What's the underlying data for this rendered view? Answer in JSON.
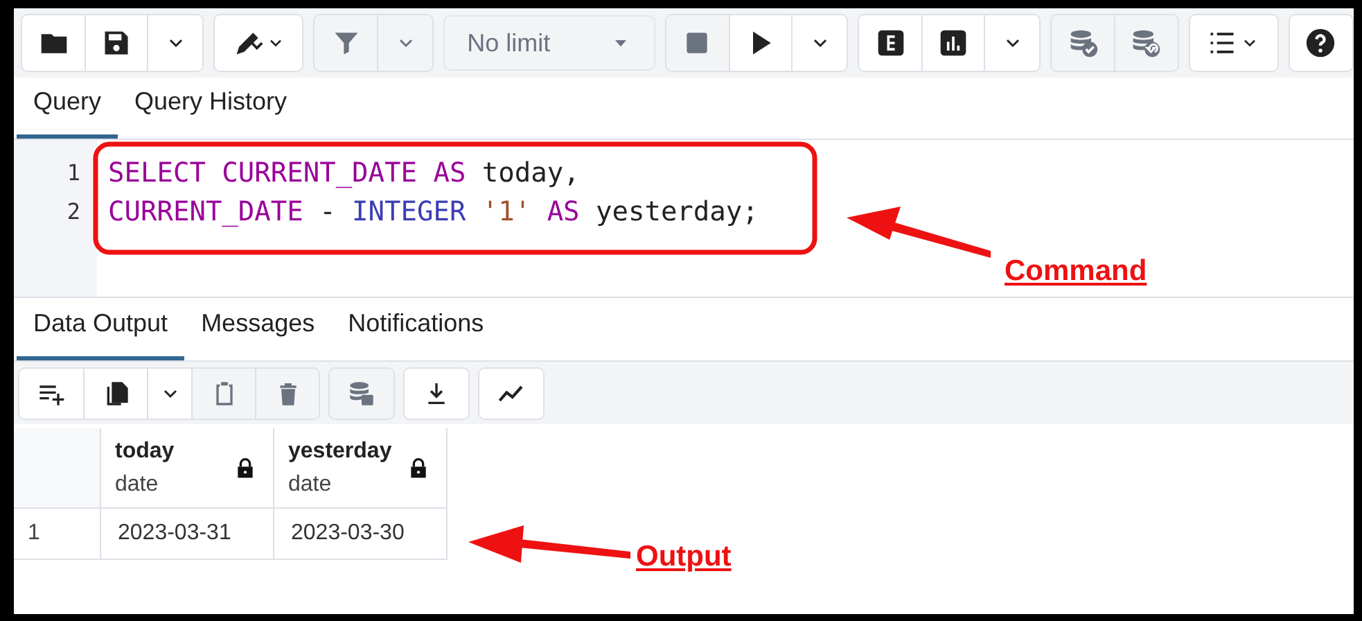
{
  "toolbar": [
    [
      {
        "kind": "folder",
        "disabled": false
      },
      {
        "kind": "save",
        "disabled": false
      },
      {
        "kind": "caret",
        "disabled": false
      }
    ],
    [
      {
        "kind": "pen",
        "disabled": false
      }
    ],
    [
      {
        "kind": "filter",
        "disabled": true
      },
      {
        "kind": "caret",
        "disabled": true
      }
    ],
    [
      {
        "kind": "select",
        "value": "No limit",
        "disabled": true
      }
    ],
    [
      {
        "kind": "stop",
        "disabled": true
      },
      {
        "kind": "play",
        "disabled": false
      },
      {
        "kind": "caret",
        "disabled": false
      }
    ],
    [
      {
        "kind": "explain",
        "disabled": false
      },
      {
        "kind": "analyze",
        "disabled": false
      },
      {
        "kind": "caret",
        "disabled": false
      }
    ],
    [
      {
        "kind": "commit",
        "disabled": true
      },
      {
        "kind": "rollback",
        "disabled": true
      }
    ],
    [
      {
        "kind": "macros",
        "disabled": false
      }
    ],
    [
      {
        "kind": "help",
        "disabled": false
      }
    ]
  ],
  "editor_tabs": [
    {
      "label": "Query",
      "selected": true
    },
    {
      "label": "Query History",
      "selected": false
    }
  ],
  "code_lines": [
    {
      "number": "1",
      "tokens": [
        {
          "kind": "keyword",
          "text": "SELECT"
        },
        {
          "kind": "keyword",
          "text": "CURRENT_DATE"
        },
        {
          "kind": "keyword",
          "text": "AS"
        },
        {
          "kind": "plain",
          "text": "today,"
        }
      ]
    },
    {
      "number": "2",
      "tokens": [
        {
          "kind": "keyword",
          "text": "CURRENT_DATE"
        },
        {
          "kind": "plain",
          "text": "-"
        },
        {
          "kind": "type",
          "text": "INTEGER"
        },
        {
          "kind": "string",
          "text": "'1'"
        },
        {
          "kind": "keyword",
          "text": "AS"
        },
        {
          "kind": "plain",
          "text": "yesterday;"
        }
      ]
    }
  ],
  "output_tabs": [
    {
      "label": "Data Output",
      "selected": true
    },
    {
      "label": "Messages",
      "selected": false
    },
    {
      "label": "Notifications",
      "selected": false
    }
  ],
  "output_toolbar": [
    [
      {
        "kind": "add-row",
        "disabled": false
      },
      {
        "kind": "copy",
        "disabled": false
      },
      {
        "kind": "caret",
        "disabled": false
      },
      {
        "kind": "paste",
        "disabled": true
      },
      {
        "kind": "delete",
        "disabled": true
      }
    ],
    [
      {
        "kind": "save-data",
        "disabled": true
      }
    ],
    [
      {
        "kind": "download",
        "disabled": false
      }
    ],
    [
      {
        "kind": "graph",
        "disabled": false
      }
    ]
  ],
  "table": {
    "columns": [
      {
        "name": "today",
        "type": "date",
        "locked": true
      },
      {
        "name": "yesterday",
        "type": "date",
        "locked": true
      }
    ],
    "rows": [
      {
        "number": "1",
        "cells": [
          "2023-03-31",
          "2023-03-30"
        ]
      }
    ]
  },
  "annotations": [
    {
      "label": "Command"
    },
    {
      "label": "Output"
    }
  ]
}
